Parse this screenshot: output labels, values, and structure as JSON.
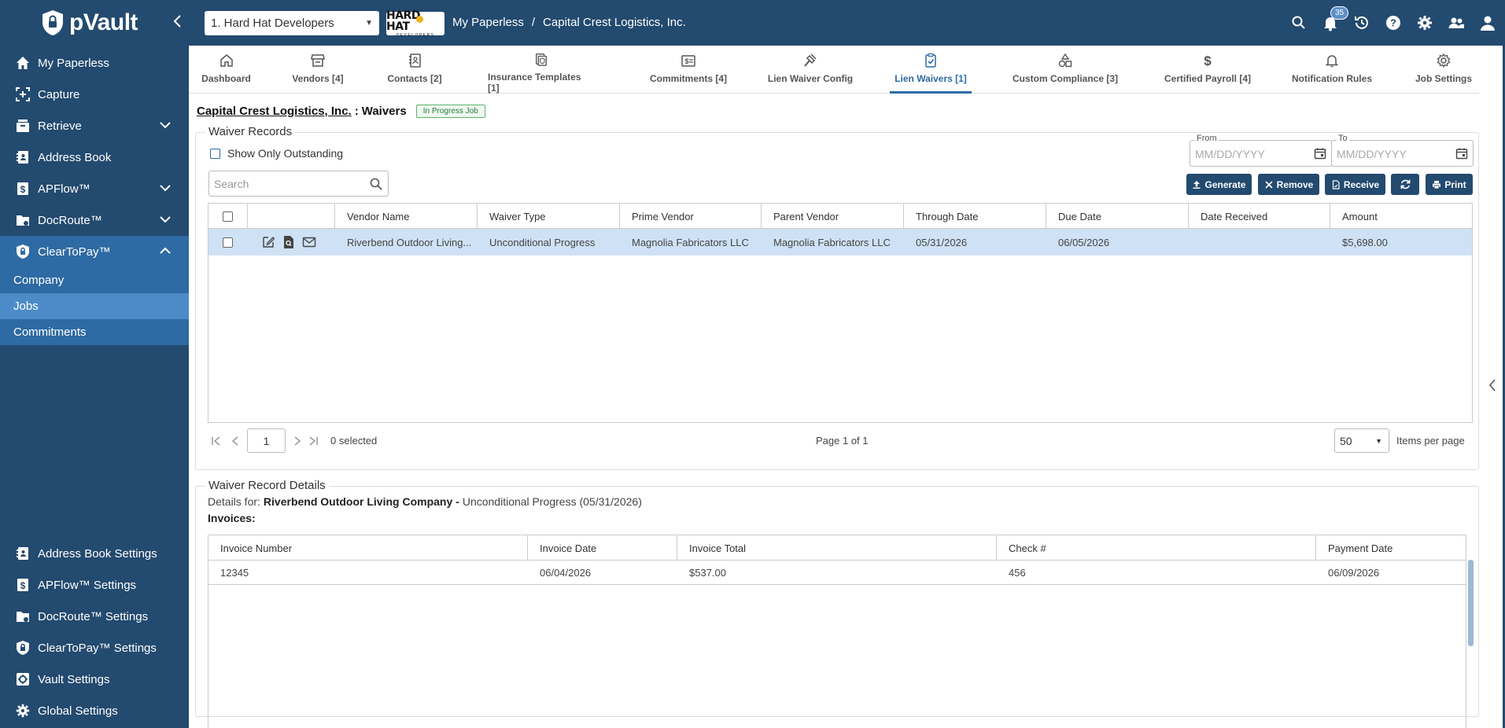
{
  "app": {
    "name": "pVault",
    "vault_select": "1. Hard Hat Developers",
    "logo_text": "HARD HAT",
    "logo_sub": "DEVELOPERS",
    "breadcrumb": [
      "My Paperless",
      "/",
      "Capital Crest Logistics, Inc."
    ],
    "notification_count": "35"
  },
  "sidebar": {
    "items": [
      {
        "label": "My Paperless",
        "icon": "home-icon"
      },
      {
        "label": "Capture",
        "icon": "capture-icon"
      },
      {
        "label": "Retrieve",
        "icon": "retrieve-icon"
      },
      {
        "label": "Address Book",
        "icon": "address-book-icon"
      },
      {
        "label": "APFlow™",
        "icon": "apflow-icon"
      },
      {
        "label": "DocRoute™",
        "icon": "docroute-icon"
      },
      {
        "label": "ClearToPay™",
        "icon": "cleartopay-icon"
      }
    ],
    "sub_items": [
      "Company",
      "Jobs",
      "Commitments"
    ],
    "settings": [
      "Address Book Settings",
      "APFlow™ Settings",
      "DocRoute™ Settings",
      "ClearToPay™ Settings",
      "Vault Settings",
      "Global Settings"
    ]
  },
  "tabs": [
    {
      "label": "Dashboard",
      "icon": "home-icon"
    },
    {
      "label": "Vendors [4]",
      "icon": "store-icon"
    },
    {
      "label": "Contacts [2]",
      "icon": "contacts-icon"
    },
    {
      "label": "Insurance Templates [1]",
      "icon": "insurance-icon"
    },
    {
      "label": "Commitments [4]",
      "icon": "commitments-icon"
    },
    {
      "label": "Lien Waiver Config",
      "icon": "hammer-icon"
    },
    {
      "label": "Lien Waivers [1]",
      "icon": "clipboard-check-icon"
    },
    {
      "label": "Custom Compliance [3]",
      "icon": "shapes-icon"
    },
    {
      "label": "Certified Payroll [4]",
      "icon": "dollar-icon"
    },
    {
      "label": "Notification Rules",
      "icon": "bell-icon"
    },
    {
      "label": "Job Settings",
      "icon": "gear-icon"
    }
  ],
  "page": {
    "company_link": "Capital Crest Logistics, Inc.",
    "separator": ":",
    "section": "Waivers",
    "status": "In Progress Job"
  },
  "waiver_records": {
    "legend": "Waiver Records",
    "outstanding_label": "Show Only Outstanding",
    "from_label": "From",
    "to_label": "To",
    "date_placeholder": "MM/DD/YYYY",
    "search_placeholder": "Search",
    "buttons": {
      "generate": "Generate",
      "remove": "Remove",
      "receive": "Receive",
      "print": "Print"
    },
    "columns": [
      "Vendor Name",
      "Waiver Type",
      "Prime Vendor",
      "Parent Vendor",
      "Through Date",
      "Due Date",
      "Date Received",
      "Amount"
    ],
    "rows": [
      {
        "vendor_name": "Riverbend Outdoor Living...",
        "waiver_type": "Unconditional Progress",
        "prime_vendor": "Magnolia Fabricators LLC",
        "parent_vendor": "Magnolia Fabricators LLC",
        "through_date": "05/31/2026",
        "due_date": "06/05/2026",
        "date_received": "",
        "amount": "$5,698.00"
      }
    ],
    "pager": {
      "page": "1",
      "selected": "0 selected",
      "page_of": "Page 1 of 1",
      "items_per_page": "50",
      "items_per_page_label": "Items per page"
    }
  },
  "details": {
    "legend": "Waiver Record Details",
    "details_for_label": "Details for:",
    "vendor": "Riverbend Outdoor Living Company -",
    "waiver_desc": "Unconditional Progress (05/31/2026)",
    "invoices_label": "Invoices:",
    "columns": [
      "Invoice Number",
      "Invoice Date",
      "Invoice Total",
      "Check #",
      "Payment Date"
    ],
    "rows": [
      {
        "invoice_number": "12345",
        "invoice_date": "06/04/2026",
        "invoice_total": "$537.00",
        "check": "456",
        "payment_date": "06/09/2026"
      }
    ]
  }
}
